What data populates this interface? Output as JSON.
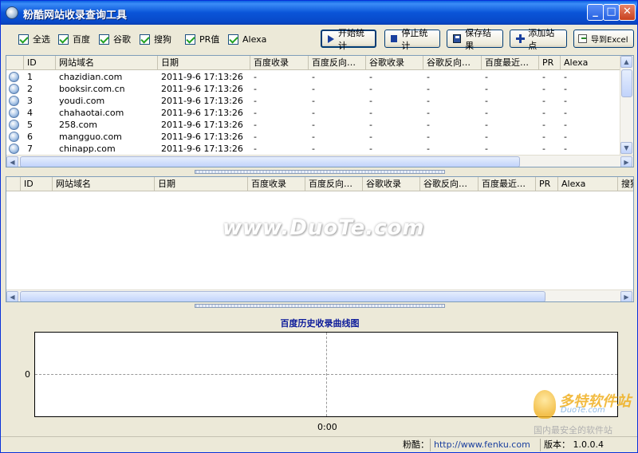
{
  "window": {
    "title": "粉酷网站收录查询工具"
  },
  "toolbar": {
    "checkboxes": [
      {
        "label": "全选",
        "checked": true
      },
      {
        "label": "百度",
        "checked": true
      },
      {
        "label": "谷歌",
        "checked": true
      },
      {
        "label": "搜狗",
        "checked": true
      },
      {
        "label": "PR值",
        "checked": true
      },
      {
        "label": "Alexa",
        "checked": true
      }
    ],
    "buttons": {
      "start": "开始统计",
      "stop": "停止统计",
      "save": "保存结果",
      "add": "添加站点",
      "export": "导到Excel"
    }
  },
  "top_grid": {
    "columns": [
      "ID",
      "网站域名",
      "日期",
      "百度收录",
      "百度反向…",
      "谷歌收录",
      "谷歌反向…",
      "百度最近…",
      "PR",
      "Alexa"
    ],
    "rows": [
      {
        "id": "1",
        "domain": "chazidian.com",
        "date": "2011-9-6 17:13:26",
        "v": [
          "-",
          "-",
          "-",
          "-",
          "-",
          "-",
          "-"
        ]
      },
      {
        "id": "2",
        "domain": "booksir.com.cn",
        "date": "2011-9-6 17:13:26",
        "v": [
          "-",
          "-",
          "-",
          "-",
          "-",
          "-",
          "-"
        ]
      },
      {
        "id": "3",
        "domain": "youdi.com",
        "date": "2011-9-6 17:13:26",
        "v": [
          "-",
          "-",
          "-",
          "-",
          "-",
          "-",
          "-"
        ]
      },
      {
        "id": "4",
        "domain": "chahaotai.com",
        "date": "2011-9-6 17:13:26",
        "v": [
          "-",
          "-",
          "-",
          "-",
          "-",
          "-",
          "-"
        ]
      },
      {
        "id": "5",
        "domain": "258.com",
        "date": "2011-9-6 17:13:26",
        "v": [
          "-",
          "-",
          "-",
          "-",
          "-",
          "-",
          "-"
        ]
      },
      {
        "id": "6",
        "domain": "mangguo.com",
        "date": "2011-9-6 17:13:26",
        "v": [
          "-",
          "-",
          "-",
          "-",
          "-",
          "-",
          "-"
        ]
      },
      {
        "id": "7",
        "domain": "chinapp.com",
        "date": "2011-9-6 17:13:26",
        "v": [
          "-",
          "-",
          "-",
          "-",
          "-",
          "-",
          "-"
        ]
      }
    ]
  },
  "bottom_grid": {
    "columns": [
      "ID",
      "网站域名",
      "日期",
      "百度收录",
      "百度反向…",
      "谷歌收录",
      "谷歌反向…",
      "百度最近…",
      "PR",
      "Alexa",
      "搜狗"
    ]
  },
  "chart": {
    "title": "百度历史收录曲线图",
    "y_tick": "0",
    "x_tick": "0:00"
  },
  "chart_data": {
    "type": "line",
    "title": "百度历史收录曲线图",
    "x": [
      "0:00"
    ],
    "series": [],
    "yticks": [
      "0"
    ],
    "grid": true
  },
  "watermark": {
    "text": "www.DuoTe.com",
    "brand": "多特软件站",
    "brand_url": "DuoTe.com",
    "slogan": "国内最安全的软件站"
  },
  "status": {
    "label": "粉酷：",
    "url": "http://www.fenku.com",
    "version": "版本： 1.0.0.4"
  }
}
